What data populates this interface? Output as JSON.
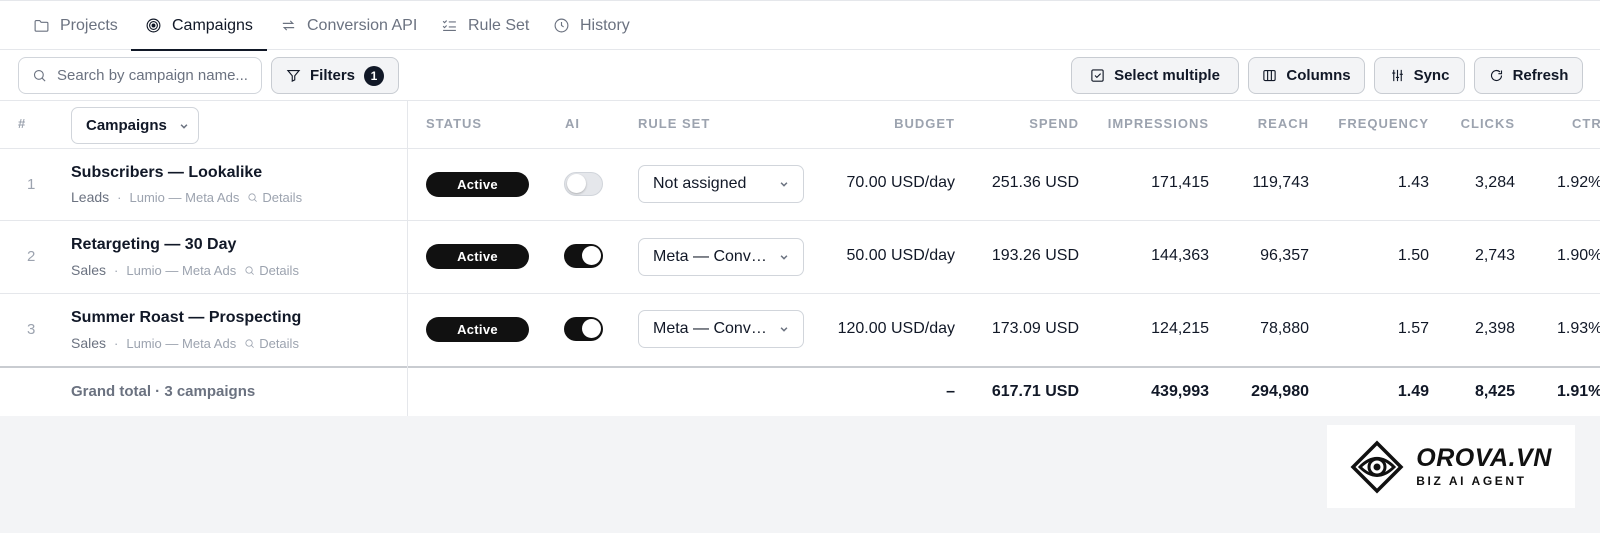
{
  "tabs": [
    {
      "label": "Projects",
      "icon": "folder-icon",
      "active": false
    },
    {
      "label": "Campaigns",
      "icon": "target-icon",
      "active": true
    },
    {
      "label": "Conversion API",
      "icon": "sync-arrows-icon",
      "active": false
    },
    {
      "label": "Rule Set",
      "icon": "checklist-icon",
      "active": false
    },
    {
      "label": "History",
      "icon": "clock-icon",
      "active": false
    }
  ],
  "toolbar": {
    "search_placeholder": "Search by campaign name...",
    "filters_label": "Filters",
    "filters_count": "1",
    "select_multiple_label": "Select multiple",
    "columns_label": "Columns",
    "sync_label": "Sync",
    "refresh_label": "Refresh"
  },
  "table": {
    "headers": {
      "index": "#",
      "campaigns": "Campaigns",
      "status": "STATUS",
      "ai": "AI",
      "rule_set": "RULE SET",
      "budget": "BUDGET",
      "spend": "SPEND",
      "impressions": "IMPRESSIONS",
      "reach": "REACH",
      "frequency": "FREQUENCY",
      "clicks": "CLICKS",
      "ctr": "CTR"
    },
    "rows": [
      {
        "index": "1",
        "name": "Subscribers — Lookalike",
        "objective": "Leads",
        "account": "Lumio — Meta Ads",
        "details": "Details",
        "status": "Active",
        "ai_enabled": false,
        "rule_set": "Not assigned",
        "budget": "70.00 USD/day",
        "spend": "251.36 USD",
        "impressions": "171,415",
        "reach": "119,743",
        "frequency": "1.43",
        "clicks": "3,284",
        "ctr": "1.92%"
      },
      {
        "index": "2",
        "name": "Retargeting — 30 Day",
        "objective": "Sales",
        "account": "Lumio — Meta Ads",
        "details": "Details",
        "status": "Active",
        "ai_enabled": true,
        "rule_set": "Meta — Conversions",
        "budget": "50.00 USD/day",
        "spend": "193.26 USD",
        "impressions": "144,363",
        "reach": "96,357",
        "frequency": "1.50",
        "clicks": "2,743",
        "ctr": "1.90%"
      },
      {
        "index": "3",
        "name": "Summer Roast — Prospecting",
        "objective": "Sales",
        "account": "Lumio — Meta Ads",
        "details": "Details",
        "status": "Active",
        "ai_enabled": true,
        "rule_set": "Meta — Conversions",
        "budget": "120.00 USD/day",
        "spend": "173.09 USD",
        "impressions": "124,215",
        "reach": "78,880",
        "frequency": "1.57",
        "clicks": "2,398",
        "ctr": "1.93%"
      }
    ],
    "totals": {
      "label": "Grand total · 3 campaigns",
      "budget": "–",
      "spend": "617.71 USD",
      "impressions": "439,993",
      "reach": "294,980",
      "frequency": "1.49",
      "clicks": "8,425",
      "ctr": "1.91%"
    }
  },
  "logo": {
    "name": "OROVA.VN",
    "tagline": "BIZ AI AGENT"
  },
  "colors": {
    "accent": "#111111",
    "muted_text": "#9ca3af",
    "border": "#e5e7eb",
    "background": "#f3f4f6"
  }
}
